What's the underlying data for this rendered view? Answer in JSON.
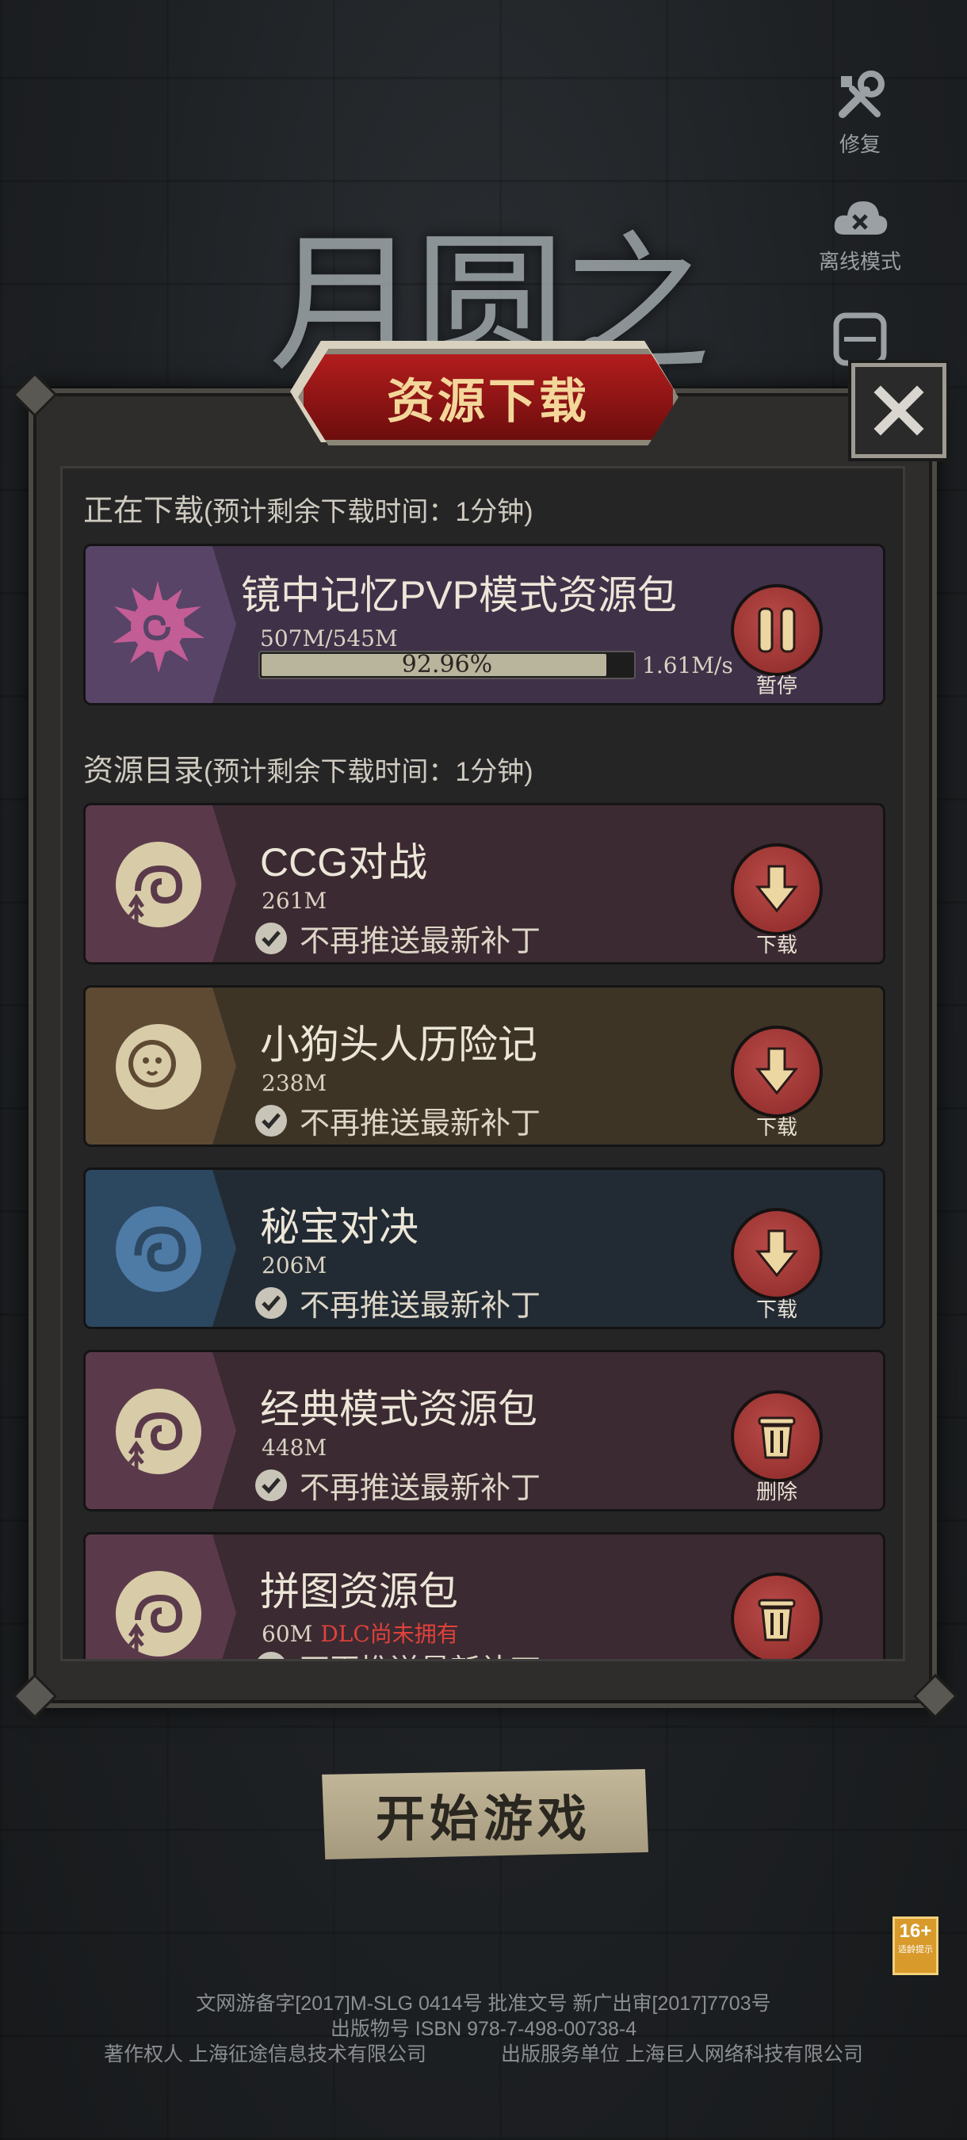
{
  "side": {
    "repair": "修复",
    "offline": "离线模式"
  },
  "dialog": {
    "title": "资源下载"
  },
  "downloading": {
    "header": "正在下载",
    "header_sub": "(预计剩余下载时间：1分钟)",
    "item": {
      "name": "镜中记忆PVP模式资源包",
      "size": "507M/545M",
      "progress_text": "92.96%",
      "progress": 0.9296,
      "speed": "1.61M/s",
      "action": "暂停",
      "color": "#3f3148"
    }
  },
  "catalog": {
    "header": "资源目录",
    "header_sub": "(预计剩余下载时间：1分钟)",
    "items": [
      {
        "name": "CCG对战",
        "size": "261M",
        "checkbox": "不再推送最新补丁",
        "action": "下载",
        "icon": "download-icon",
        "color": "#3b2a31"
      },
      {
        "name": "小狗头人历险记",
        "size": "238M",
        "checkbox": "不再推送最新补丁",
        "action": "下载",
        "icon": "download-icon",
        "color": "#3e3426"
      },
      {
        "name": "秘宝对决",
        "size": "206M",
        "checkbox": "不再推送最新补丁",
        "action": "下载",
        "icon": "download-icon",
        "color": "#222b34"
      },
      {
        "name": "经典模式资源包",
        "size": "448M",
        "checkbox": "不再推送最新补丁",
        "action": "删除",
        "icon": "trash-icon",
        "color": "#3b2a31"
      },
      {
        "name": "拼图资源包",
        "size": "60M",
        "dlc": "DLC尚未拥有",
        "checkbox": "不再推送最新补丁",
        "action": "",
        "icon": "trash-icon",
        "color": "#3b2a31"
      }
    ]
  },
  "start_button": "开始游戏",
  "age_rating": {
    "age": "16+",
    "label": "适龄提示"
  },
  "footer": {
    "line1": "文网游备字[2017]M-SLG 0414号 批准文号 新广出审[2017]7703号",
    "line2": "出版物号 ISBN 978-7-498-00738-4",
    "line3_left": "著作权人 上海征途信息技术有限公司",
    "line3_right": "出版服务单位 上海巨人网络科技有限公司"
  }
}
